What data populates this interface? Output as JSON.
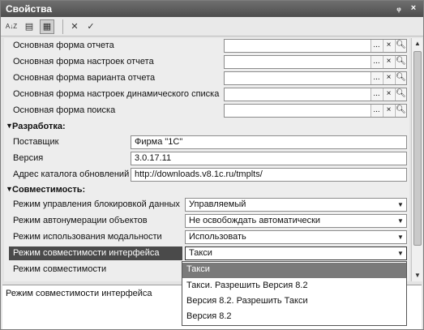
{
  "window": {
    "title": "Свойства",
    "pin": "ᵩ",
    "close": "×"
  },
  "toolbar": {
    "sort_label": "A↓Z",
    "categories_label": "▤",
    "filter_label": "▦",
    "delete_label": "✕",
    "confirm_label": "✓"
  },
  "forms": [
    {
      "label": "Основная форма отчета",
      "value": ""
    },
    {
      "label": "Основная форма настроек отчета",
      "value": ""
    },
    {
      "label": "Основная форма варианта отчета",
      "value": ""
    },
    {
      "label": "Основная форма настроек динамического списка",
      "value": ""
    },
    {
      "label": "Основная форма поиска",
      "value": ""
    }
  ],
  "picker_buttons": {
    "dots": "...",
    "clear": "×",
    "search": "🔍︎"
  },
  "section_dev": {
    "title": "Разработка:",
    "toggle": "▼"
  },
  "dev_fields": [
    {
      "label": "Поставщик",
      "value": "Фирма \"1С\""
    },
    {
      "label": "Версия",
      "value": "3.0.17.11"
    },
    {
      "label": "Адрес каталога обновлений",
      "value": "http://downloads.v8.1c.ru/tmplts/"
    }
  ],
  "section_compat": {
    "title": "Совместимость:",
    "toggle": "▼"
  },
  "compat_fields": [
    {
      "label": "Режим управления блокировкой данных",
      "value": "Управляемый"
    },
    {
      "label": "Режим автонумерации объектов",
      "value": "Не освобождать автоматически"
    },
    {
      "label": "Режим использования модальности",
      "value": "Использовать"
    },
    {
      "label": "Режим совместимости интерфейса",
      "value": "Такси"
    },
    {
      "label": "Режим совместимости",
      "value": ""
    }
  ],
  "dropdown": {
    "options": [
      "Такси",
      "Такси. Разрешить Версия 8.2",
      "Версия 8.2. Разрешить Такси",
      "Версия 8.2"
    ],
    "selected_index": 0
  },
  "description": {
    "text": "Режим совместимости интерфейса"
  },
  "scroll": {
    "up": "▲",
    "down": "▼"
  },
  "select_arrow": "▼"
}
